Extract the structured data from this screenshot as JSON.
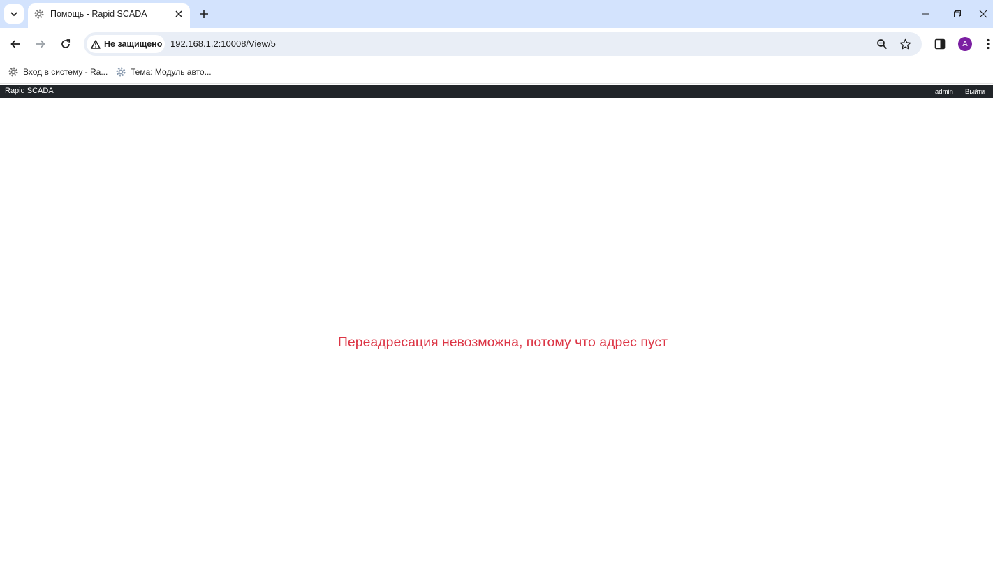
{
  "browser": {
    "tab": {
      "title": "Помощь - Rapid SCADA",
      "favicon": "gear-icon"
    },
    "address_bar": {
      "security_label": "Не защищено",
      "url": "192.168.1.2:10008/View/5"
    },
    "profile_initial": "A",
    "profile_color": "#7b1fa2",
    "bookmarks": [
      {
        "label": "Вход в систему - Ra...",
        "icon": "gear-icon"
      },
      {
        "label": "Тема: Модуль авто...",
        "icon": "gear-icon"
      }
    ]
  },
  "app": {
    "brand": "Rapid SCADA",
    "user": "admin",
    "logout_label": "Выйти",
    "header_color": "#212529"
  },
  "content": {
    "error_message": "Переадресация невозможна, потому что адрес пуст",
    "error_color": "#dc3545"
  }
}
